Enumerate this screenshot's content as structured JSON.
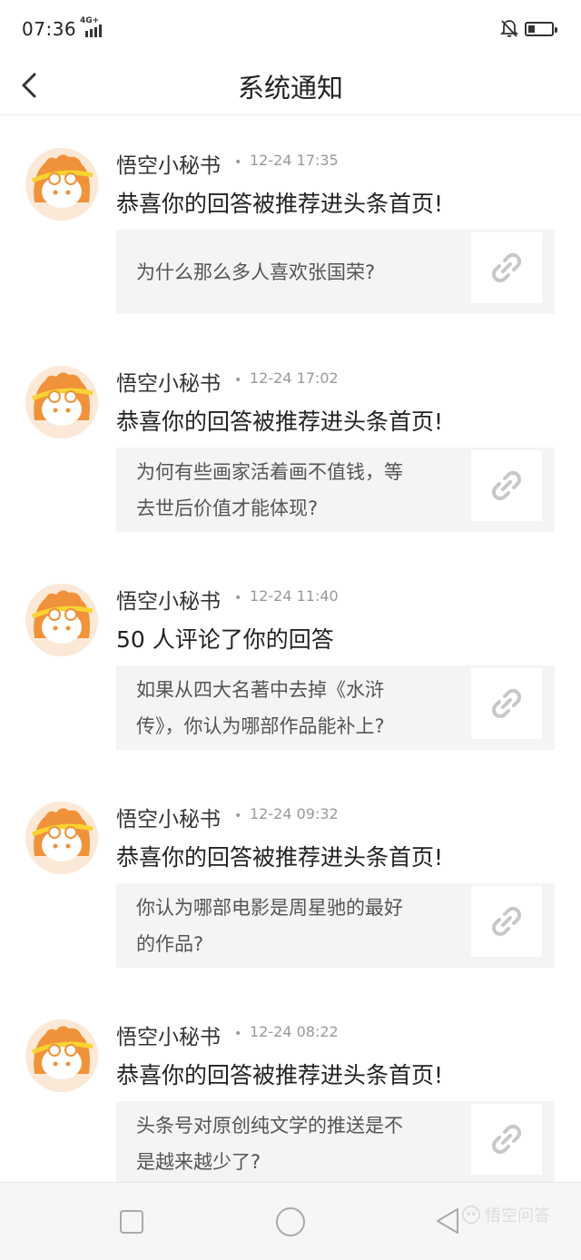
{
  "status_bar": {
    "time": "07:36",
    "network": "4G+"
  },
  "header": {
    "title": "系统通知",
    "back_icon": "chevron-left-icon"
  },
  "notifications": [
    {
      "sender": "悟空小秘书",
      "time": "12-24 17:35",
      "message": "恭喜你的回答被推荐进头条首页!",
      "question_lines": [
        "为什么那么多人喜欢张国荣?"
      ]
    },
    {
      "sender": "悟空小秘书",
      "time": "12-24 17:02",
      "message": "恭喜你的回答被推荐进头条首页!",
      "question_lines": [
        "为何有些画家活着画不值钱，等",
        "去世后价值才能体现?"
      ]
    },
    {
      "sender": "悟空小秘书",
      "time": "12-24 11:40",
      "message": "50 人评论了你的回答",
      "question_lines": [
        "如果从四大名著中去掉《水浒",
        "传》，你认为哪部作品能补上?"
      ]
    },
    {
      "sender": "悟空小秘书",
      "time": "12-24 09:32",
      "message": "恭喜你的回答被推荐进头条首页!",
      "question_lines": [
        "你认为哪部电影是周星驰的最好",
        "的作品?"
      ]
    },
    {
      "sender": "悟空小秘书",
      "time": "12-24 08:22",
      "message": "恭喜你的回答被推荐进头条首页!",
      "question_lines": [
        "头条号对原创纯文学的推送是不",
        "是越来越少了?"
      ]
    }
  ],
  "watermark": "悟空问答",
  "colors": {
    "avatar_orange": "#f0923a",
    "avatar_yellow": "#f7d433",
    "card_bg": "#f4f4f4"
  }
}
